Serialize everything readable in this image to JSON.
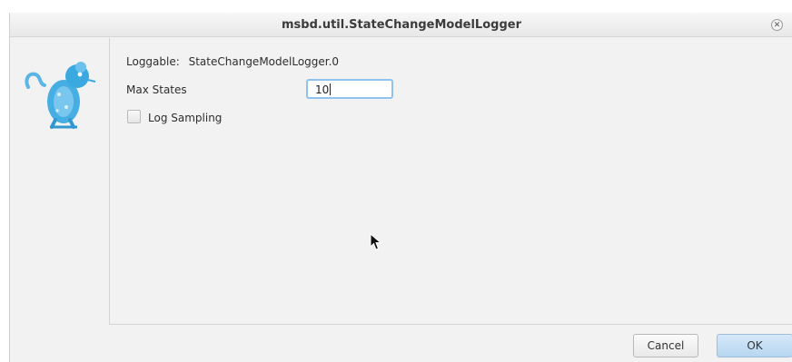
{
  "window": {
    "title": "msbd.util.StateChangeModelLogger",
    "close_icon": "close-icon"
  },
  "logo": {
    "icon": "rat-logo-icon",
    "color": "#3aa9e0"
  },
  "form": {
    "loggable_label": "Loggable:",
    "loggable_value": "StateChangeModelLogger.0",
    "max_states_label": "Max States",
    "max_states_value": "10",
    "log_sampling_label": "Log Sampling",
    "log_sampling_checked": false
  },
  "buttons": {
    "cancel_label": "Cancel",
    "ok_label": "OK"
  },
  "colors": {
    "accent": "#8fc2ec",
    "ok_button": "#c6dff5",
    "dialog_bg": "#f2f2f2"
  }
}
